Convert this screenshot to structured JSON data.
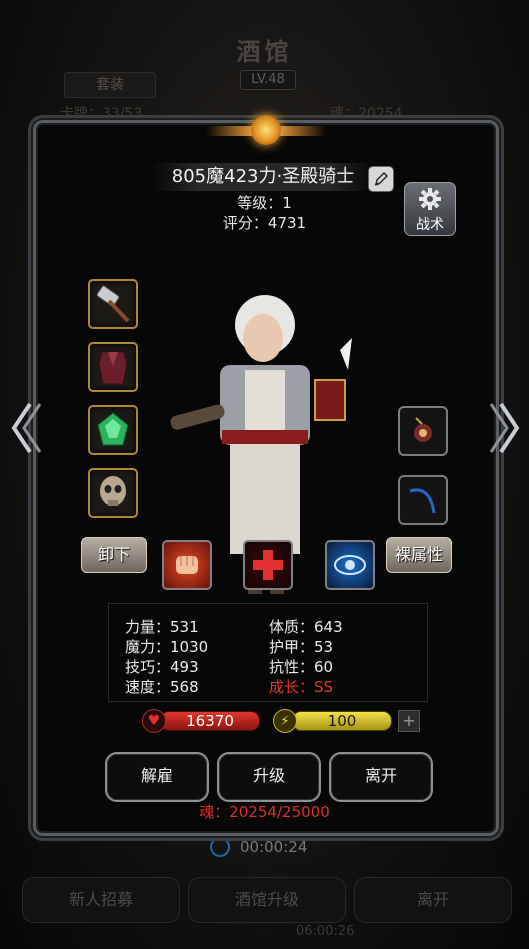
{
  "background": {
    "title": "酒馆",
    "level_badge": "LV.48",
    "set_button": "套装",
    "count_text": "卡牌：33/53",
    "soul_text": "魂：20254",
    "timer": "00:00:24",
    "buttons": [
      "新人招募",
      "酒馆升级",
      "离开"
    ],
    "bottom_timer": "06:00:26"
  },
  "hero": {
    "name": "805魔423力·圣殿骑士",
    "level_line": "等级：1",
    "score_line": "评分：4731"
  },
  "tactics_label": "战术",
  "equipment_left": [
    "hammer-icon",
    "armor-icon",
    "emerald-icon",
    "skull-mask-icon"
  ],
  "equipment_right": [
    "eye-amulet-icon",
    "blue-whip-icon"
  ],
  "unequip_label": "卸下",
  "naked_attr_label": "裸属性",
  "skills": [
    "fist-skill-icon",
    "red-cross-skill-icon",
    "blue-eye-skill-icon"
  ],
  "stats": {
    "strength": "力量：531",
    "magic": "魔力：1030",
    "skill": "技巧：493",
    "speed": "速度：568",
    "constitution": "体质：643",
    "armor": "护甲：53",
    "resistance": "抗性：60",
    "growth": "成长：SS"
  },
  "resources": {
    "hp": "16370",
    "energy": "100"
  },
  "actions": {
    "dismiss": "解雇",
    "upgrade": "升级",
    "leave": "离开"
  },
  "soul_footer": "魂：20254/25000",
  "colors": {
    "accent_gold": "#b08a2e",
    "hp_red": "#e0382e",
    "energy_yellow": "#f4e04a",
    "growth_red": "#e0392e"
  }
}
